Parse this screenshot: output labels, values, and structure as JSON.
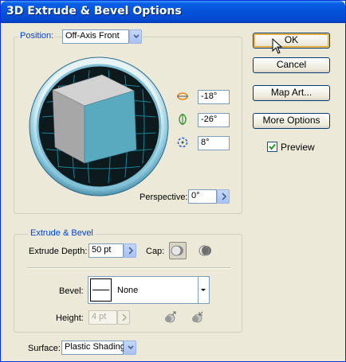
{
  "window": {
    "title": "3D Extrude & Bevel Options"
  },
  "position": {
    "label": "Position:",
    "preset": "Off-Axis Front",
    "rotate_x": "-18°",
    "rotate_y": "-26°",
    "rotate_z": "8°",
    "perspective_label": "Perspective:",
    "perspective_value": "0°"
  },
  "buttons": {
    "ok": "OK",
    "cancel": "Cancel",
    "map_art": "Map Art...",
    "more_options": "More Options",
    "preview": "Preview",
    "preview_checked": true
  },
  "extrude": {
    "group_label": "Extrude & Bevel",
    "depth_label": "Extrude Depth:",
    "depth_value": "50 pt",
    "cap_label": "Cap:",
    "bevel_label": "Bevel:",
    "bevel_value": "None",
    "height_label": "Height:",
    "height_value": "4 pt"
  },
  "surface": {
    "label": "Surface:",
    "value": "Plastic Shading"
  },
  "icons": {
    "rotate_x": "rotate-x-axis-icon",
    "rotate_y": "rotate-y-axis-icon",
    "rotate_z": "rotate-z-axis-icon",
    "cap_on": "cap-on-icon",
    "cap_off": "cap-off-icon",
    "bevel_out": "bevel-extent-out-icon",
    "bevel_in": "bevel-extent-in-icon"
  },
  "colors": {
    "title_bar": "#0453d9",
    "dialog_bg": "#ece9d8",
    "group_label": "#0046d5",
    "cube_front": "#5aaabf",
    "cube_top": "#d2d2d2",
    "cube_side": "#a7a7a7"
  }
}
